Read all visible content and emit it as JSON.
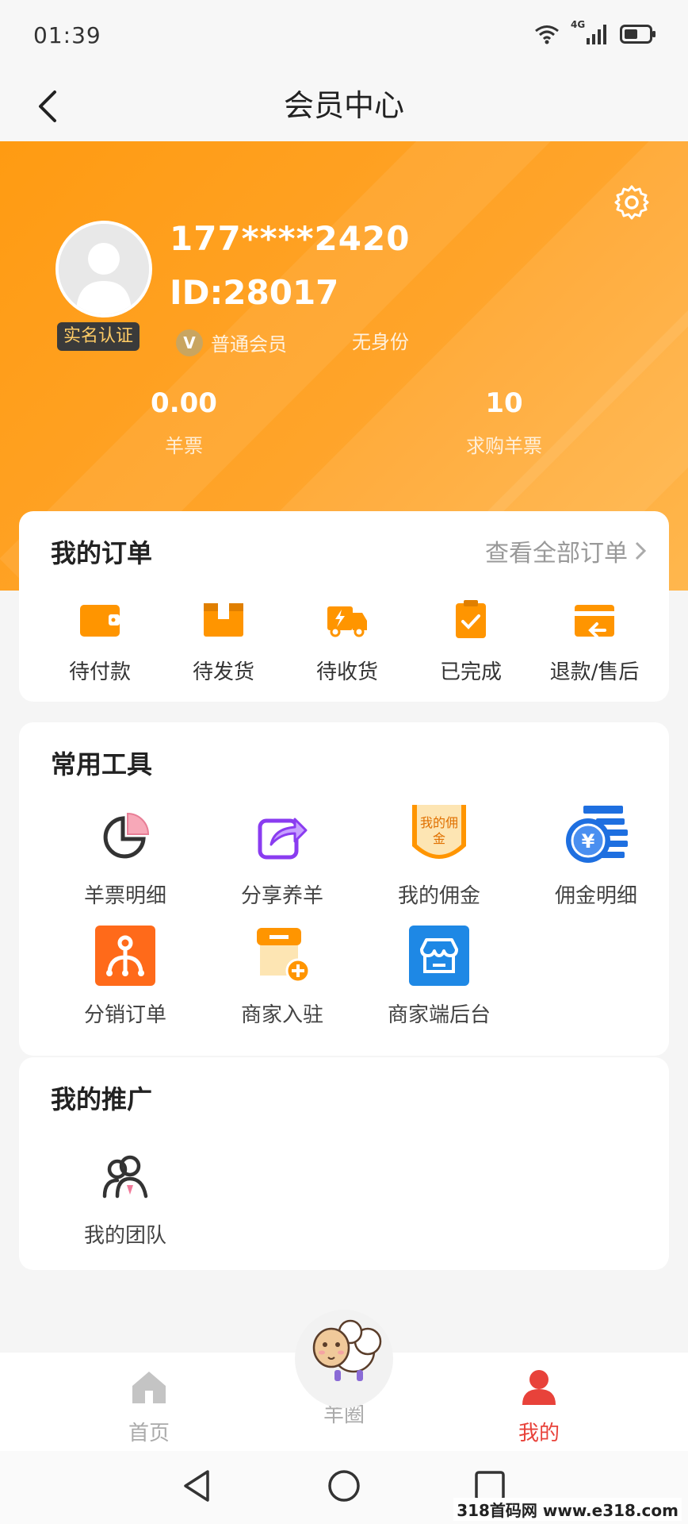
{
  "status": {
    "time": "01:39",
    "network": "4G"
  },
  "nav": {
    "title": "会员中心"
  },
  "profile": {
    "phone": "177****2420",
    "id": "ID:28017",
    "real_name_badge": "实名认证",
    "member_level": "普通会员",
    "identity": "无身份",
    "stats": [
      {
        "value": "0.00",
        "label": "羊票"
      },
      {
        "value": "10",
        "label": "求购羊票"
      }
    ]
  },
  "orders": {
    "title": "我的订单",
    "view_all": "查看全部订单",
    "items": [
      {
        "label": "待付款",
        "icon": "wallet-icon"
      },
      {
        "label": "待发货",
        "icon": "box-icon"
      },
      {
        "label": "待收货",
        "icon": "truck-icon"
      },
      {
        "label": "已完成",
        "icon": "clipboard-check-icon"
      },
      {
        "label": "退款/售后",
        "icon": "refund-icon"
      }
    ]
  },
  "tools": {
    "title": "常用工具",
    "items": [
      {
        "label": "羊票明细",
        "icon": "pie-chart-icon"
      },
      {
        "label": "分享养羊",
        "icon": "share-icon"
      },
      {
        "label": "我的佣金",
        "icon": "commission-badge-icon",
        "badge_text": "我的佣金"
      },
      {
        "label": "佣金明细",
        "icon": "coin-yuan-icon"
      },
      {
        "label": "分销订单",
        "icon": "distribution-icon"
      },
      {
        "label": "商家入驻",
        "icon": "shop-add-icon"
      },
      {
        "label": "商家端后台",
        "icon": "store-backend-icon"
      }
    ]
  },
  "promotion": {
    "title": "我的推广",
    "items": [
      {
        "label": "我的团队",
        "icon": "team-icon"
      }
    ]
  },
  "tabbar": {
    "items": [
      {
        "label": "首页",
        "icon": "home-icon",
        "active": false
      },
      {
        "label": "羊圈",
        "icon": "sheep-icon",
        "active": false
      },
      {
        "label": "我的",
        "icon": "user-icon",
        "active": true
      }
    ]
  },
  "colors": {
    "accent": "#ff9b12",
    "active_tab": "#e8423a",
    "icon_orange": "#ff9500"
  },
  "watermark": "318首码网 www.e318.com"
}
